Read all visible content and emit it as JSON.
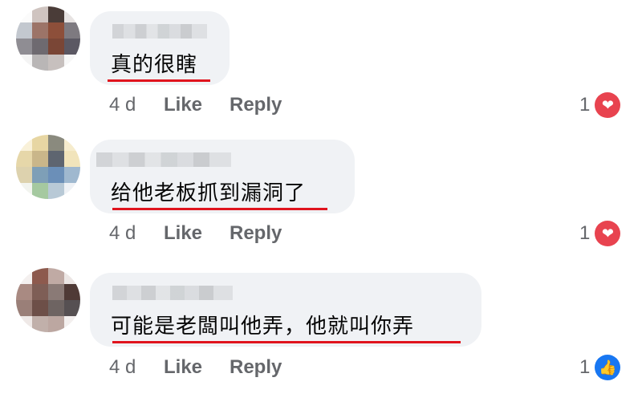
{
  "comments": [
    {
      "text": "真的很瞎",
      "time": "4 d",
      "like_label": "Like",
      "reply_label": "Reply",
      "reaction": {
        "count": "1",
        "type": "love",
        "icon": "heart-icon",
        "color": "#e8434f"
      }
    },
    {
      "text": "给他老板抓到漏洞了",
      "time": "4 d",
      "like_label": "Like",
      "reply_label": "Reply",
      "reaction": {
        "count": "1",
        "type": "love",
        "icon": "heart-icon",
        "color": "#e8434f"
      }
    },
    {
      "text": "可能是老闆叫他弄，他就叫你弄",
      "time": "4 d",
      "like_label": "Like",
      "reply_label": "Reply",
      "reaction": {
        "count": "1",
        "type": "like",
        "icon": "thumbs-up-icon",
        "color": "#1877f2"
      }
    }
  ],
  "colors": {
    "bubble": "#f0f2f5",
    "underline": "#e0141e",
    "meta_text": "#65676b"
  }
}
